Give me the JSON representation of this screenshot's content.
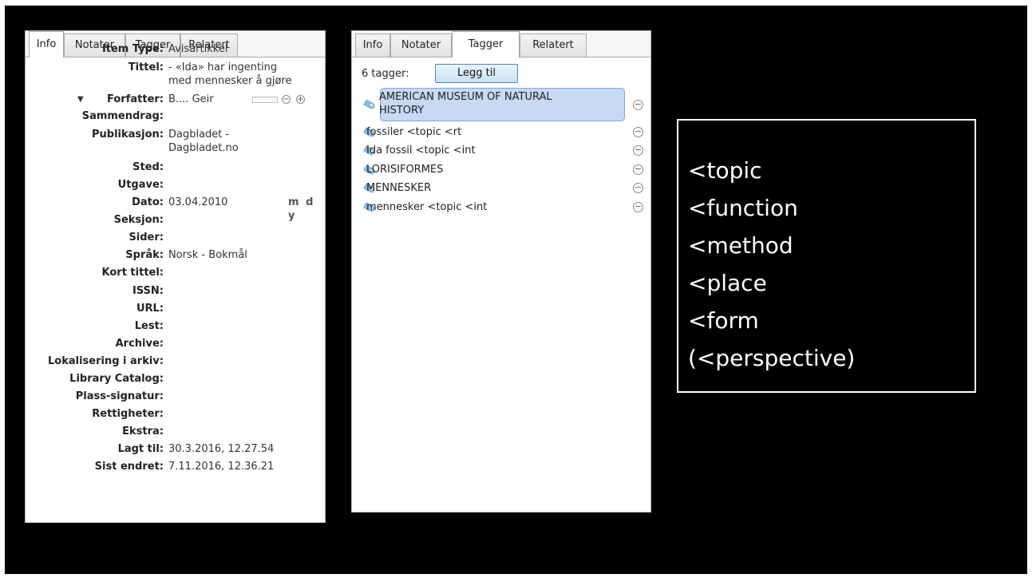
{
  "left_panel": {
    "tabs": [
      {
        "label": "Info"
      },
      {
        "label": "Notater"
      },
      {
        "label": "Tagger"
      },
      {
        "label": "Relatert"
      }
    ],
    "fields": [
      {
        "label": "Item Type:",
        "value": "Avisartikkel"
      },
      {
        "label": "Tittel:",
        "value": "- «Ida» har ingenting\nmed mennesker å gjøre"
      },
      {
        "label": "Forfatter:",
        "value": "B.... Geir"
      },
      {
        "label": "Sammendrag:",
        "value": ""
      },
      {
        "label": "Publikasjon:",
        "value": "Dagbladet -\nDagbladet.no"
      },
      {
        "label": "Sted:",
        "value": ""
      },
      {
        "label": "Utgave:",
        "value": ""
      },
      {
        "label": "Dato:",
        "value": "03.04.2010"
      },
      {
        "label": "Seksjon:",
        "value": ""
      },
      {
        "label": "Sider:",
        "value": ""
      },
      {
        "label": "Språk:",
        "value": "Norsk - Bokmål"
      },
      {
        "label": "Kort tittel:",
        "value": ""
      },
      {
        "label": "ISSN:",
        "value": ""
      },
      {
        "label": "URL:",
        "value": ""
      },
      {
        "label": "Lest:",
        "value": ""
      },
      {
        "label": "Archive:",
        "value": ""
      },
      {
        "label": "Lokalisering i arkiv:",
        "value": ""
      },
      {
        "label": "Library Catalog:",
        "value": ""
      },
      {
        "label": "Plass-signatur:",
        "value": ""
      },
      {
        "label": "Rettigheter:",
        "value": ""
      },
      {
        "label": "Ekstra:",
        "value": ""
      },
      {
        "label": "Lagt til:",
        "value": "30.3.2016, 12.27.54"
      },
      {
        "label": "Sist endret:",
        "value": "7.11.2016, 12.36.21"
      }
    ],
    "date_format": "m d y"
  },
  "right_panel": {
    "tabs": [
      {
        "label": "Info"
      },
      {
        "label": "Notater"
      },
      {
        "label": "Tagger"
      },
      {
        "label": "Relatert"
      }
    ],
    "tag_count_label": "6 tagger:",
    "add_button_label": "Legg til",
    "tags": [
      {
        "label": "AMERICAN MUSEUM OF NATURAL\nHISTORY",
        "selected": true
      },
      {
        "label": "fossiler <topic <rt",
        "selected": false
      },
      {
        "label": "Ida fossil <topic <int",
        "selected": false
      },
      {
        "label": "LORISIFORMES",
        "selected": false
      },
      {
        "label": "MENNESKER",
        "selected": false
      },
      {
        "label": "mennesker <topic <int",
        "selected": false
      }
    ]
  },
  "note_box": {
    "lines": [
      "<topic",
      "<function",
      "<method",
      "<place",
      "<form",
      "(<perspective)"
    ]
  },
  "colors": {
    "slide_background": "#000000",
    "tag_selected": "#c7d9f3",
    "tag_icon": "#8ab8dd",
    "button_border": "#4a87c7"
  }
}
